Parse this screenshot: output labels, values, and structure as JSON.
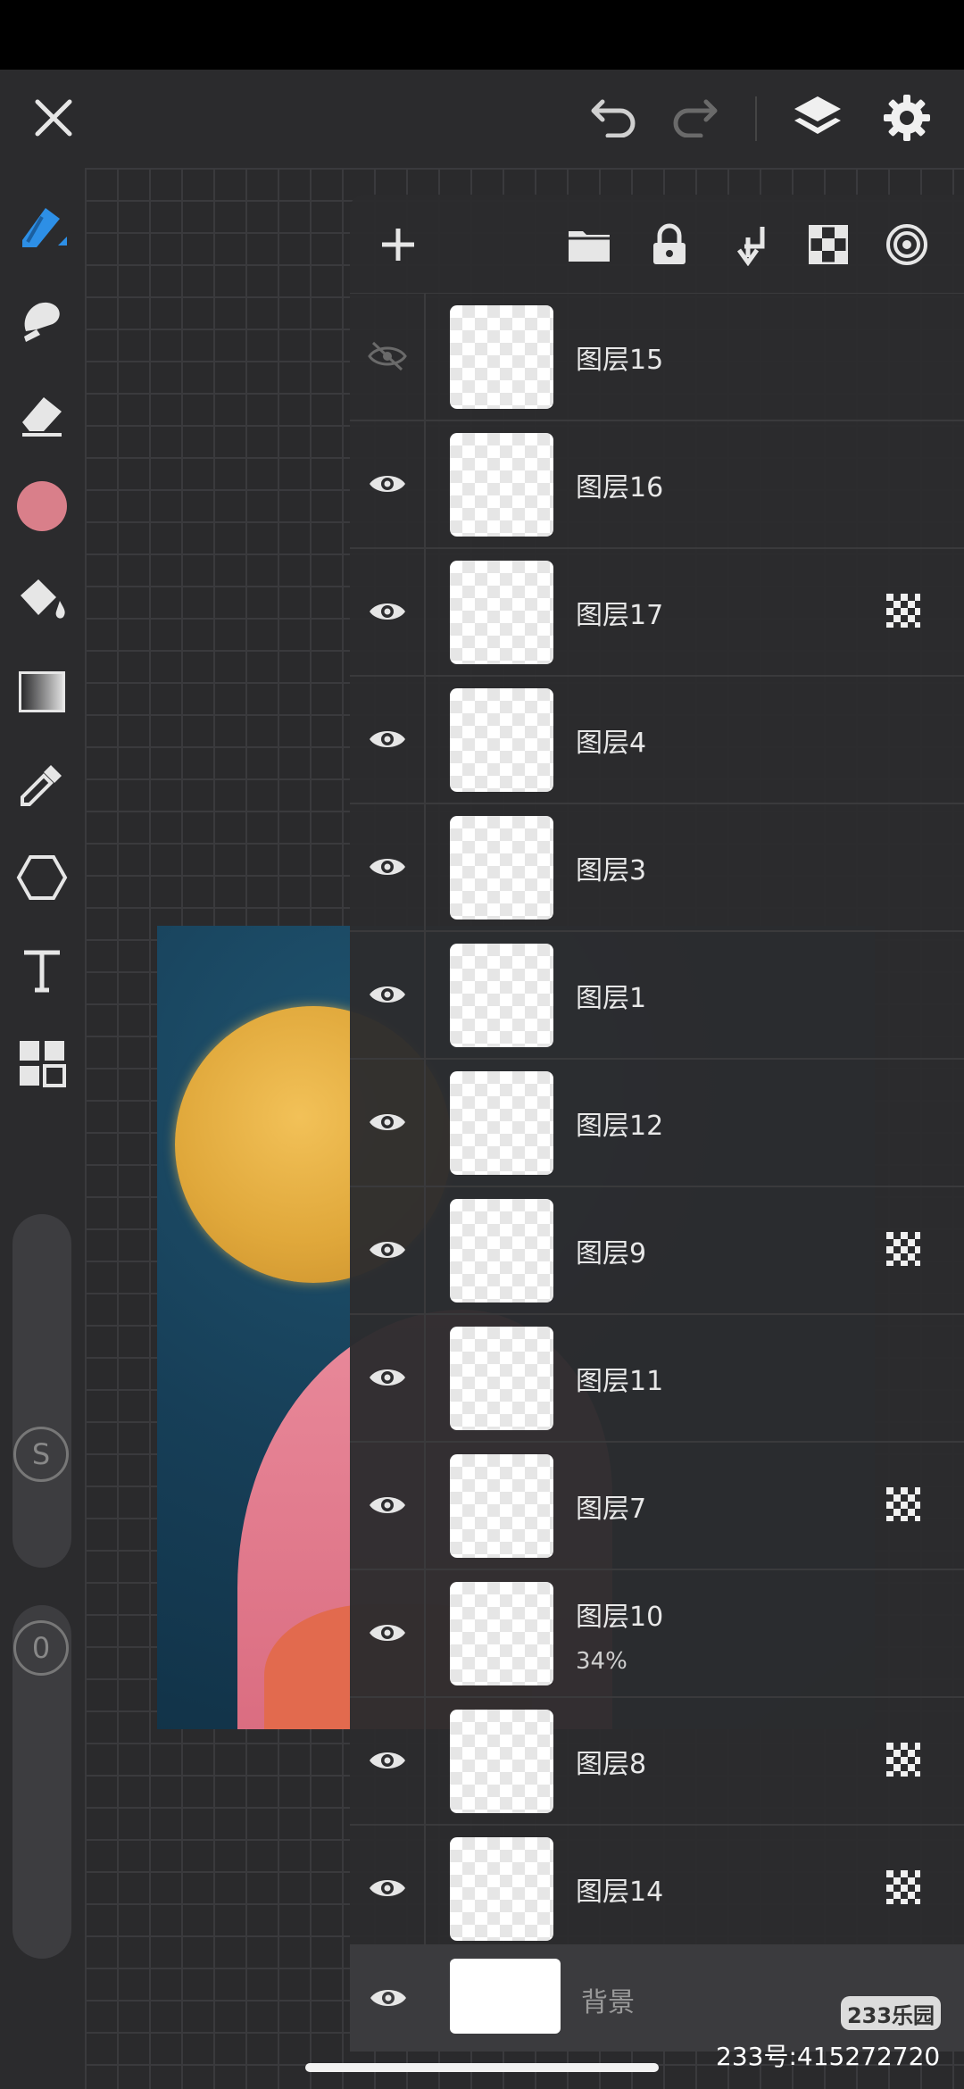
{
  "colors": {
    "accent": "#2d8fe6",
    "current_color": "#d97f8a",
    "icon": "#e6e6e6",
    "icon_dim": "#8a8a8a"
  },
  "topbar": {
    "icons": [
      "close-icon",
      "undo-icon",
      "redo-icon",
      "layers-icon",
      "settings-icon"
    ]
  },
  "toolbar": {
    "tools": [
      "brush-icon",
      "smudge-icon",
      "eraser-icon",
      "color-swatch",
      "fill-bucket-icon",
      "gradient-icon",
      "eyedropper-icon",
      "shape-icon",
      "text-icon",
      "layout-icon"
    ],
    "size_label": "S",
    "opacity_label": "0"
  },
  "layers_panel": {
    "actions": [
      "add-layer-icon",
      "folder-icon",
      "lock-icon",
      "merge-down-icon",
      "alpha-lock-icon",
      "blend-icon"
    ],
    "layers": [
      {
        "name": "图层15",
        "visible": false,
        "alpha_lock": false,
        "opacity": ""
      },
      {
        "name": "图层16",
        "visible": true,
        "alpha_lock": false,
        "opacity": ""
      },
      {
        "name": "图层17",
        "visible": true,
        "alpha_lock": true,
        "opacity": ""
      },
      {
        "name": "图层4",
        "visible": true,
        "alpha_lock": false,
        "opacity": ""
      },
      {
        "name": "图层3",
        "visible": true,
        "alpha_lock": false,
        "opacity": ""
      },
      {
        "name": "图层1",
        "visible": true,
        "alpha_lock": false,
        "opacity": ""
      },
      {
        "name": "图层12",
        "visible": true,
        "alpha_lock": false,
        "opacity": ""
      },
      {
        "name": "图层9",
        "visible": true,
        "alpha_lock": true,
        "opacity": ""
      },
      {
        "name": "图层11",
        "visible": true,
        "alpha_lock": false,
        "opacity": ""
      },
      {
        "name": "图层7",
        "visible": true,
        "alpha_lock": true,
        "opacity": ""
      },
      {
        "name": "图层10",
        "visible": true,
        "alpha_lock": false,
        "opacity": "34%"
      },
      {
        "name": "图层8",
        "visible": true,
        "alpha_lock": true,
        "opacity": ""
      },
      {
        "name": "图层14",
        "visible": true,
        "alpha_lock": true,
        "opacity": ""
      }
    ],
    "background_layer": {
      "name": "背景",
      "visible": true
    }
  },
  "watermark": {
    "logo_text": "233乐园",
    "id_text": "233号:415272720"
  }
}
